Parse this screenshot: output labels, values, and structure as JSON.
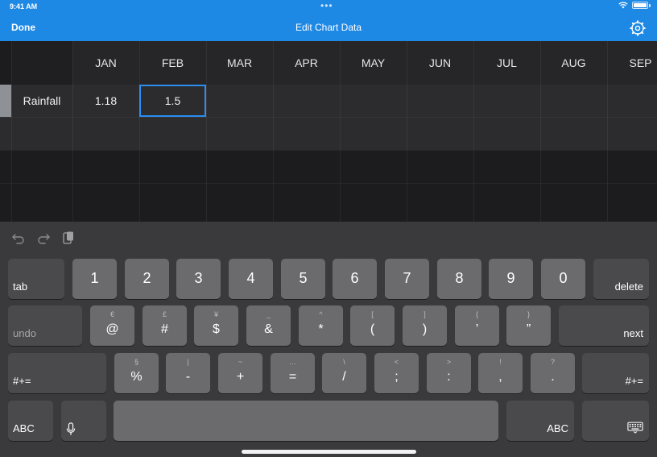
{
  "status_bar": {
    "time": "9:41 AM",
    "dots": "•••"
  },
  "nav": {
    "done_label": "Done",
    "title": "Edit Chart Data"
  },
  "sheet": {
    "columns": [
      "JAN",
      "FEB",
      "MAR",
      "APR",
      "MAY",
      "JUN",
      "JUL",
      "AUG",
      "SEP"
    ],
    "rows": [
      {
        "label": "Rainfall",
        "cells": [
          "1.18",
          "1.5",
          "",
          "",
          "",
          "",
          "",
          "",
          ""
        ]
      }
    ],
    "selected_cell": {
      "row": 0,
      "col": 1
    },
    "selection_color": "#2b8ef0"
  },
  "keyboard": {
    "toolbar": [
      "undo-icon",
      "redo-icon",
      "paste-icon"
    ],
    "row1": {
      "left": "tab",
      "keys": [
        "1",
        "2",
        "3",
        "4",
        "5",
        "6",
        "7",
        "8",
        "9",
        "0"
      ],
      "right": "delete"
    },
    "row2": {
      "left": "undo",
      "keys": [
        {
          "main": "@",
          "sub": "€"
        },
        {
          "main": "#",
          "sub": "£"
        },
        {
          "main": "$",
          "sub": "¥"
        },
        {
          "main": "&",
          "sub": "_"
        },
        {
          "main": "*",
          "sub": "^"
        },
        {
          "main": "(",
          "sub": "["
        },
        {
          "main": ")",
          "sub": "]"
        },
        {
          "main": "’",
          "sub": "{"
        },
        {
          "main": "”",
          "sub": "}"
        }
      ],
      "right": "next"
    },
    "row3": {
      "left": "#+=",
      "keys": [
        {
          "main": "%",
          "sub": "§"
        },
        {
          "main": "-",
          "sub": "|"
        },
        {
          "main": "+",
          "sub": "~"
        },
        {
          "main": "=",
          "sub": "…"
        },
        {
          "main": "/",
          "sub": "\\"
        },
        {
          "main": ";",
          "sub": "<"
        },
        {
          "main": ":",
          "sub": ">"
        },
        {
          "main": ",",
          "sub": "!"
        },
        {
          "main": ".",
          "sub": "?"
        }
      ],
      "right": "#+="
    },
    "row4": {
      "left": "ABC",
      "right": "ABC"
    }
  },
  "colors": {
    "nav_blue": "#1e88e5",
    "keyboard_bg": "#3a3a3c",
    "key": "#6b6b6e",
    "key_dark": "#4a4a4c"
  }
}
